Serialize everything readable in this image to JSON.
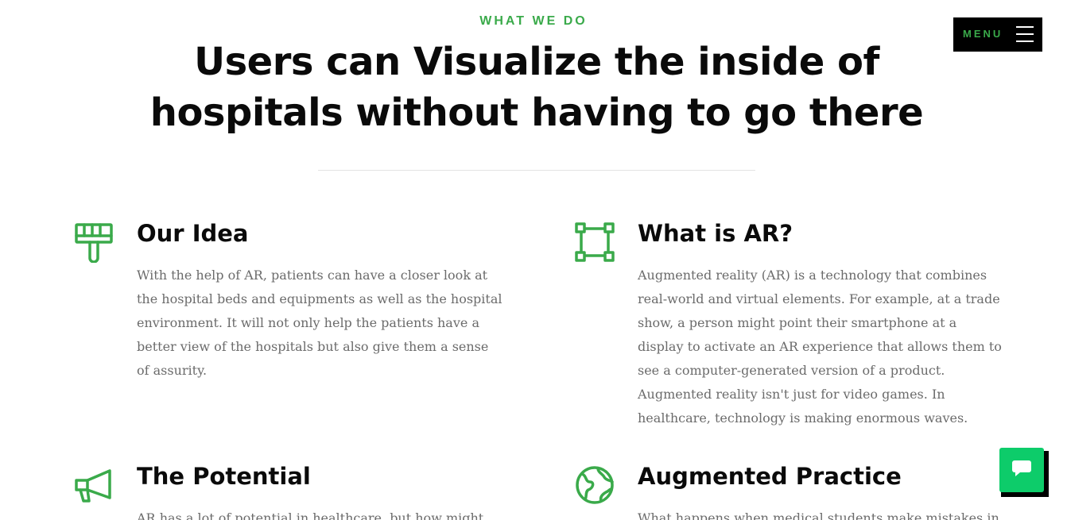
{
  "section": {
    "eyebrow": "WHAT WE DO",
    "headline": "Users can Visualize the inside of hospitals without having to go there"
  },
  "menu": {
    "label": "MENU",
    "icon": "hamburger-icon"
  },
  "features": [
    {
      "icon": "paint-brush-icon",
      "title": "Our Idea",
      "text": "With the help of AR, patients can have a closer look at the hospital beds and equipments as well as the hospital environment. It will not only help the patients have a better view of the hospitals but also give them a sense of assurity."
    },
    {
      "icon": "vector-square-icon",
      "title": "What is AR?",
      "text": "Augmented reality (AR) is a technology that combines real-world and virtual elements. For example, at a trade show, a person might point their smartphone at a display to activate an AR experience that allows them to see a computer-generated version of a product. Augmented reality isn't just for video games. In healthcare, technology is making enormous waves."
    },
    {
      "icon": "megaphone-icon",
      "title": "The Potential",
      "text": "AR has a lot of potential in healthcare, but how might"
    },
    {
      "icon": "globe-icon",
      "title": "Augmented Practice",
      "text": "What happens when medical students make mistakes in"
    }
  ],
  "chat": {
    "icon": "chat-bubble-icon"
  },
  "colors": {
    "accent": "#3aaa4a",
    "chat": "#0dcc6a",
    "heading": "#0a0a0a",
    "body_text": "#6b6b6b",
    "menu_bg": "#000000"
  }
}
